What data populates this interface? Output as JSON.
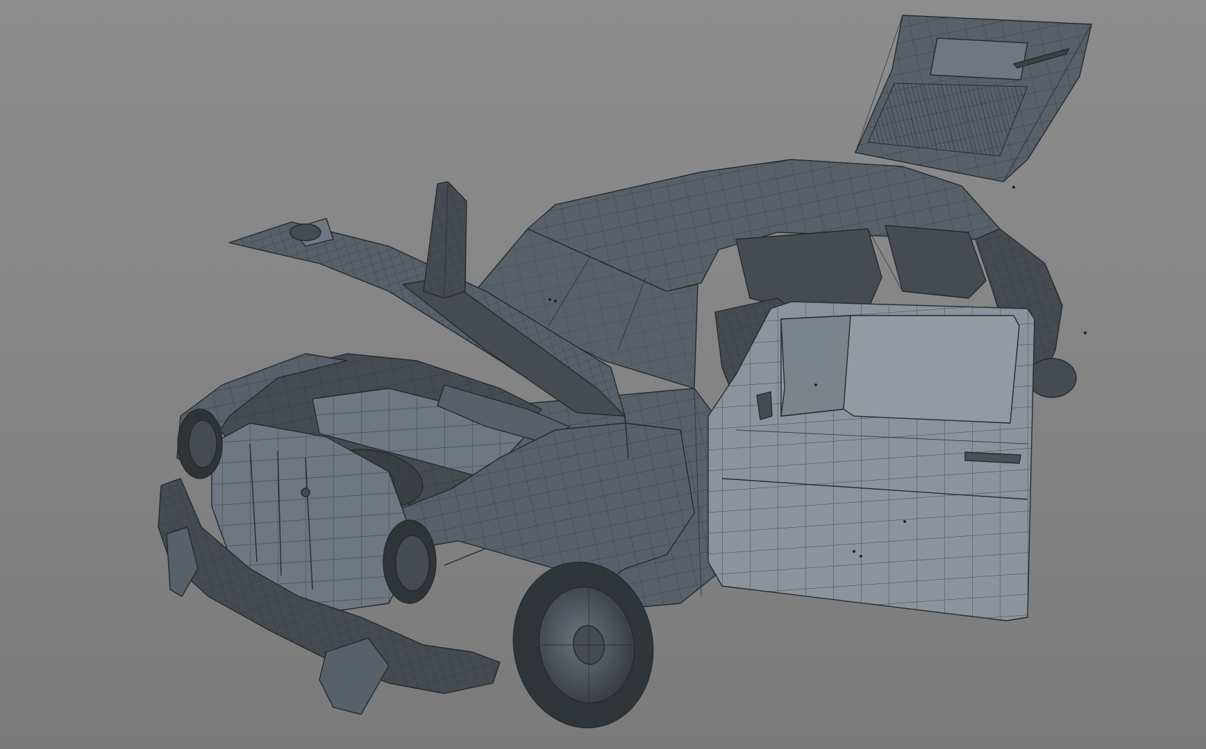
{
  "scene": {
    "subject": "car-wireframe-model",
    "colors": {
      "background_top": "#8d8d8d",
      "background_bottom": "#7b7b7b",
      "body_dark": "#454b51",
      "body_mid": "#58606a",
      "body_light": "#6e7782",
      "door_panel": "#8b939c",
      "wire": "#26292c"
    }
  }
}
